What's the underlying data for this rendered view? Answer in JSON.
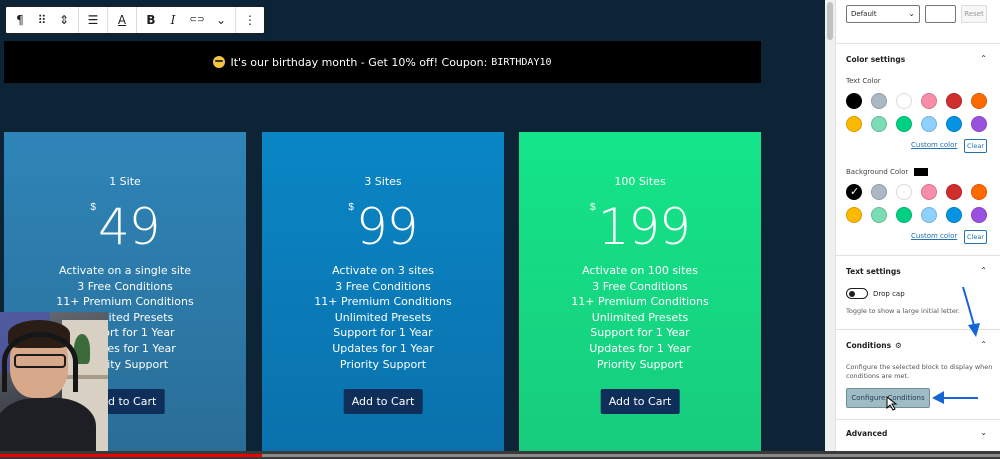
{
  "toolbar": {
    "buttons": [
      {
        "icon": "paragraph-icon",
        "glyph": "¶"
      },
      {
        "icon": "drag-handle-icon",
        "glyph": "⠿"
      },
      {
        "icon": "move-up-down-icon",
        "glyph": "⇕"
      },
      {
        "icon": "align-icon",
        "glyph": "☰"
      },
      {
        "icon": "text-color-icon",
        "glyph": "A"
      },
      {
        "icon": "bold-icon",
        "glyph": "B"
      },
      {
        "icon": "italic-icon",
        "glyph": "I"
      },
      {
        "icon": "link-icon",
        "glyph": "⊂⊃"
      },
      {
        "icon": "more-formats-icon",
        "glyph": "⌄"
      },
      {
        "icon": "options-icon",
        "glyph": "⋮"
      }
    ]
  },
  "banner": {
    "text": "It's our birthday month - Get 10% off! Coupon:",
    "coupon": "BIRTHDAY10"
  },
  "cards": [
    {
      "title": "1 Site",
      "currency": "$",
      "price": "49",
      "features": [
        "Activate on a single site",
        "3 Free Conditions",
        "11+ Premium Conditions",
        "Unlimited Presets",
        "Support for 1 Year",
        "Updates for 1 Year",
        "Priority Support"
      ],
      "button": "Add to Cart"
    },
    {
      "title": "3 Sites",
      "currency": "$",
      "price": "99",
      "features": [
        "Activate on 3 sites",
        "3 Free Conditions",
        "11+ Premium Conditions",
        "Unlimited Presets",
        "Support for 1 Year",
        "Updates for 1 Year",
        "Priority Support"
      ],
      "button": "Add to Cart"
    },
    {
      "title": "100 Sites",
      "currency": "$",
      "price": "199",
      "features": [
        "Activate on 100 sites",
        "3 Free Conditions",
        "11+ Premium Conditions",
        "Unlimited Presets",
        "Support for 1 Year",
        "Updates for 1 Year",
        "Priority Support"
      ],
      "button": "Add to Cart"
    }
  ],
  "sidebar": {
    "typography": {
      "select_value": "Default",
      "reset": "Reset"
    },
    "color_settings": {
      "heading": "Color settings",
      "text_color_label": "Text Color",
      "background_color_label": "Background Color",
      "palette": [
        "#000000",
        "#abb8c3",
        "#ffffff",
        "#f78da7",
        "#cf2e2e",
        "#ff6900",
        "#fcb900",
        "#7bdcb5",
        "#00d084",
        "#8ed1fc",
        "#0693e3",
        "#9b51e0"
      ],
      "background_selected_index": 0,
      "custom_color": "Custom color",
      "clear": "Clear"
    },
    "text_settings": {
      "heading": "Text settings",
      "drop_cap_label": "Drop cap",
      "drop_cap_help": "Toggle to show a large initial letter."
    },
    "conditions": {
      "heading": "Conditions",
      "help": "Configure the selected block to display when conditions are met.",
      "button": "Configure Conditions"
    },
    "advanced": {
      "heading": "Advanced"
    }
  },
  "colors": {
    "annotation_arrow": "#1565d8",
    "progress_played": "#ee0000"
  }
}
